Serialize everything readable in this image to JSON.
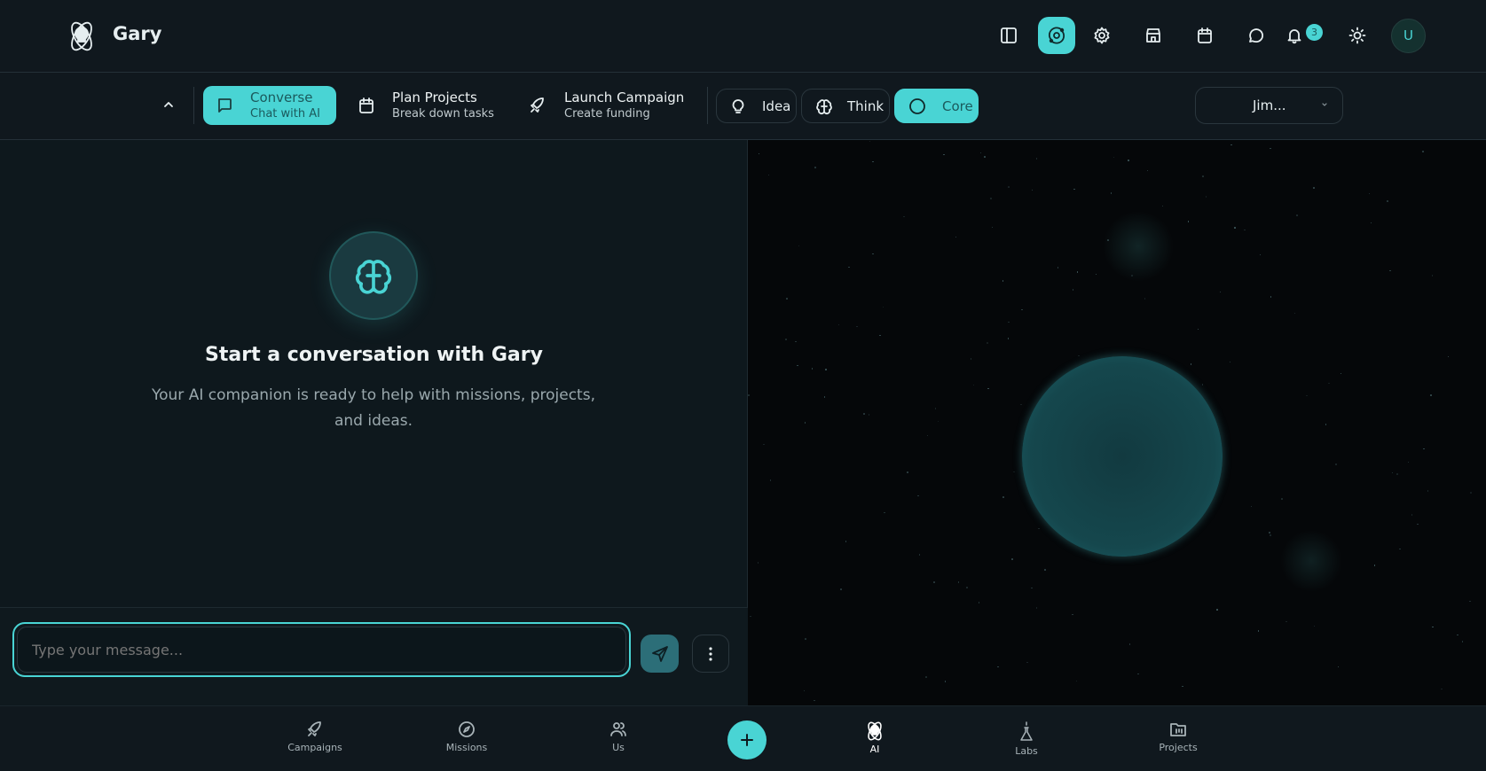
{
  "app": {
    "title": "Gary"
  },
  "header": {
    "notification_count": "3",
    "avatar_initial": "U"
  },
  "toolbar": {
    "modes": [
      {
        "title": "Converse",
        "subtitle": "Chat with AI"
      },
      {
        "title": "Plan Projects",
        "subtitle": "Break down tasks"
      },
      {
        "title": "Launch Campaign",
        "subtitle": "Create funding"
      }
    ],
    "pills": [
      {
        "label": "Idea"
      },
      {
        "label": "Think"
      },
      {
        "label": "Core"
      }
    ],
    "persona_select": "Jim..."
  },
  "chat": {
    "empty_title": "Start a conversation with Gary",
    "empty_subtitle": "Your AI companion is ready to help with missions, projects, and ideas.",
    "input_placeholder": "Type your message..."
  },
  "bottom_nav": [
    {
      "label": "Campaigns"
    },
    {
      "label": "Missions"
    },
    {
      "label": "Us"
    },
    {
      "label": "AI"
    },
    {
      "label": "Labs"
    },
    {
      "label": "Projects"
    }
  ],
  "colors": {
    "accent": "#49d4d4",
    "background": "#0f171d",
    "visual_bg": "#050709"
  }
}
